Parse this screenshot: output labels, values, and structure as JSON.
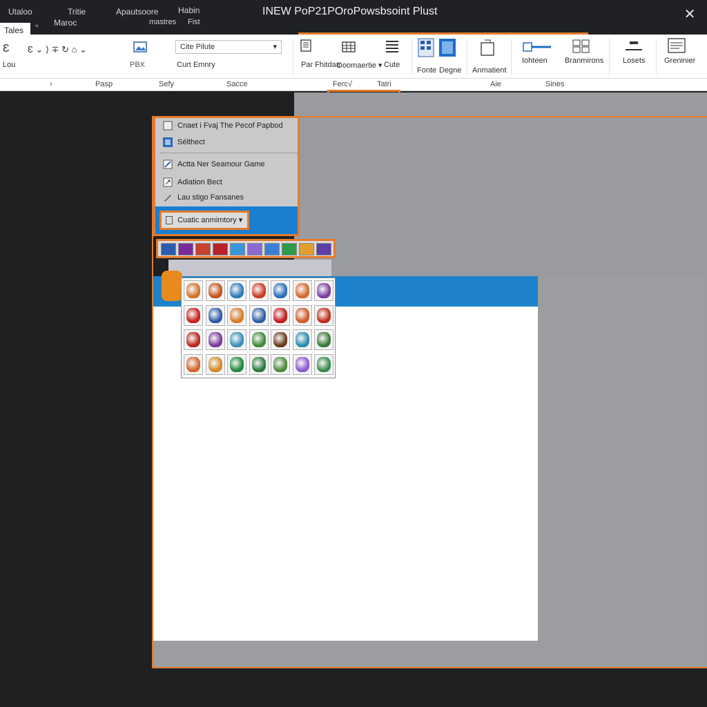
{
  "titlebar": {
    "title": "INEW PoP21POroPowsbsoint Plust",
    "tabs": [
      "Utaloo",
      "Tritie",
      "Apautsoore",
      "Habin"
    ],
    "subtabs": [
      "Maroc",
      "mastres",
      "Fist"
    ],
    "active_tab": "Tales",
    "close": "✕"
  },
  "ribbon": {
    "lou_label": "Lou",
    "font_combo": "Cite Pilute",
    "font_combo_arrow": "▾",
    "pbx_label": "PBX",
    "cut_label": "Curt Emnry",
    "paragraph_label": "Par Fhitdan",
    "documentation_label": "Doomaertie ▾",
    "cute_label": "Cute",
    "fonte_label": "Fonte",
    "degne_label": "Degne",
    "animation_label": "Anmatient",
    "lohteen_label": "Iohteen",
    "brandons_label": "Branmirons",
    "losets_label": "Losets",
    "greenier_label": "Greninier",
    "toolbar_glyphs": "Ɛ  ⌄  ⟩ ∓ ↻ ⌂ ⌄"
  },
  "groups": {
    "pasp": "Pasp",
    "sefy": "Sefy",
    "sace": "Sacce",
    "fercit": "Ferc√",
    "tatri": "Tatri",
    "aie": "Aie",
    "sines": "Sines"
  },
  "menu": {
    "items": [
      "Cnaet i Fvaj  The Pecof Papbod",
      "Sélthect",
      "Actta Ner Seamour Game",
      "Adiation Bect",
      "Lau stigo Fansanes"
    ],
    "styled_button": "Cuatic anmimtory ▾"
  },
  "colors": {
    "accent": "#e47b2c",
    "blue": "#1e82cc",
    "dark": "#1e2022",
    "gray_pane": "#9a9b9e"
  }
}
